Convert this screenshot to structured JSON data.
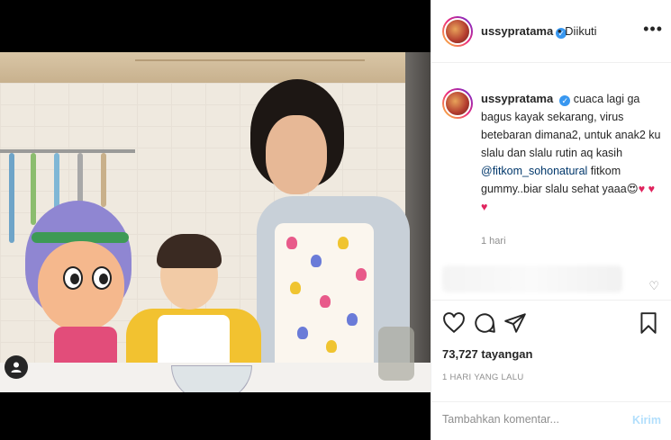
{
  "post": {
    "username": "ussypratama",
    "verified_icon": "verified-badge",
    "follow_status": "• Diikuti",
    "more_icon": "•••"
  },
  "caption": {
    "username": "ussypratama",
    "text_before_mention": "cuaca lagi ga bagus kayak sekarang, virus betebaran dimana2, untuk anak2 ku slalu dan slalu rutin aq kasih",
    "mention": "@fitkom_sohonatural",
    "text_after_mention": "fitkom gummy..biar slalu sehat yaaa",
    "emoji_face": "😍",
    "hearts": "♥ ♥ ♥",
    "time": "1 hari"
  },
  "stats": {
    "views": "73,727 tayangan",
    "posted": "1 HARI YANG LALU"
  },
  "comment": {
    "placeholder": "Tambahkan komentar...",
    "post_label": "Kirim"
  },
  "colors": {
    "accent_blue": "#3897f0",
    "heart_red": "#e0245e",
    "post_button_disabled": "#b2dffc",
    "muted_text": "#8e8e8e"
  }
}
